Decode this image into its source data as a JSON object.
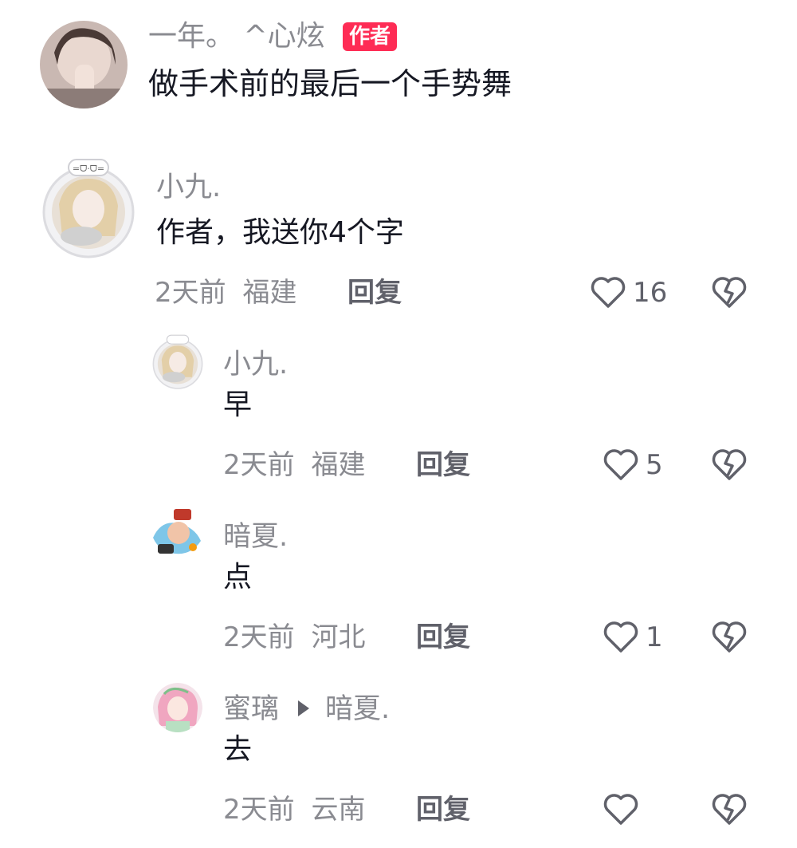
{
  "author_comment": {
    "name": "一年。 ^心炫",
    "badge": "作者",
    "text": "做手术前的最后一个手势舞"
  },
  "comments": [
    {
      "name": "小九.",
      "text": "作者，我送你4个字",
      "time": "2天前",
      "location": "福建",
      "reply_label": "回复",
      "likes": "16"
    },
    {
      "name": "小九.",
      "text": "早",
      "time": "2天前",
      "location": "福建",
      "reply_label": "回复",
      "likes": "5"
    },
    {
      "name": "暗夏.",
      "text": "点",
      "time": "2天前",
      "location": "河北",
      "reply_label": "回复",
      "likes": "1"
    },
    {
      "name": "蜜璃",
      "reply_to": "暗夏.",
      "text": "去",
      "time": "2天前",
      "location": "云南",
      "reply_label": "回复",
      "likes": ""
    }
  ],
  "icons": {
    "like": "heart-outline-icon",
    "dislike": "broken-heart-icon"
  },
  "colors": {
    "badge": "#fe2c55",
    "secondary_text": "#8a8b91",
    "action_text": "#60616a"
  }
}
